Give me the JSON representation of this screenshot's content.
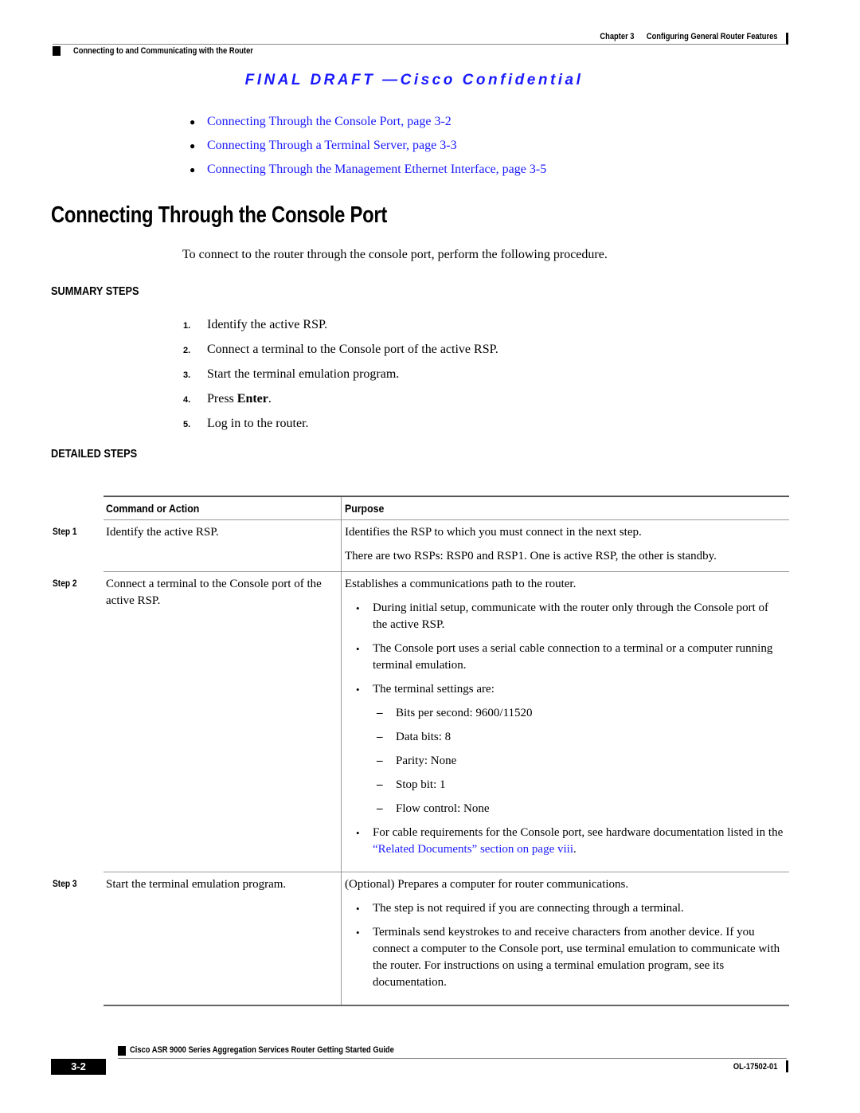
{
  "header": {
    "chapter": "Chapter 3",
    "chapter_title": "Configuring General Router Features",
    "section": "Connecting to and Communicating with the Router"
  },
  "watermark": "FINAL DRAFT —Cisco Confidential",
  "toc_links": [
    {
      "label": "Connecting Through the Console Port, page 3-2"
    },
    {
      "label": "Connecting Through a Terminal Server, page 3-3"
    },
    {
      "label": "Connecting Through the Management Ethernet Interface, page 3-5"
    }
  ],
  "section_title": "Connecting Through the Console Port",
  "intro": "To connect to the router through the console port, perform the following procedure.",
  "summary": {
    "heading": "SUMMARY STEPS",
    "steps": [
      {
        "num": "1.",
        "text": "Identify the active RSP."
      },
      {
        "num": "2.",
        "text": "Connect a terminal to the Console port of the active RSP."
      },
      {
        "num": "3.",
        "text": "Start the terminal emulation program."
      },
      {
        "num": "4.",
        "pre": "Press ",
        "bold": "Enter",
        "post": "."
      },
      {
        "num": "5.",
        "text": "Log in to the router."
      }
    ]
  },
  "detailed": {
    "heading": "DETAILED STEPS",
    "columns": [
      "Command or Action",
      "Purpose"
    ],
    "rows": [
      {
        "step": "Step 1",
        "command": "Identify the active RSP.",
        "purpose": {
          "p1": "Identifies the RSP to which you must connect in the next step.",
          "p2": "There are two RSPs: RSP0 and RSP1. One is active RSP, the other is standby."
        }
      },
      {
        "step": "Step 2",
        "command": "Connect a terminal to the Console port of the active RSP.",
        "purpose": {
          "p1": "Establishes a communications path to the router.",
          "b1": "During initial setup, communicate with the router only through the Console port of the active RSP.",
          "b2": "The Console port uses a serial cable connection to a terminal or a computer running terminal emulation.",
          "b3": "The terminal settings are:",
          "settings": [
            "Bits per second: 9600/11520",
            "Data bits: 8",
            "Parity: None",
            "Stop bit: 1",
            "Flow control: None"
          ],
          "b4_pre": "For cable requirements for the Console port, see hardware documentation listed in the ",
          "b4_link": "“Related Documents” section on page viii",
          "b4_post": "."
        }
      },
      {
        "step": "Step 3",
        "command": "Start the terminal emulation program.",
        "purpose": {
          "p1": "(Optional) Prepares a computer for router communications.",
          "b1": "The step is not required if you are connecting through a terminal.",
          "b2": "Terminals send keystrokes to and receive characters from another device. If you connect a computer to the Console port, use terminal emulation to communicate with the router. For instructions on using a terminal emulation program, see its documentation."
        }
      }
    ]
  },
  "footer": {
    "guide_title": "Cisco ASR 9000 Series Aggregation Services Router Getting Started Guide",
    "page": "3-2",
    "doc_number": "OL-17502-01"
  },
  "colors": {
    "link": "#1a1aff",
    "text": "#000000"
  }
}
